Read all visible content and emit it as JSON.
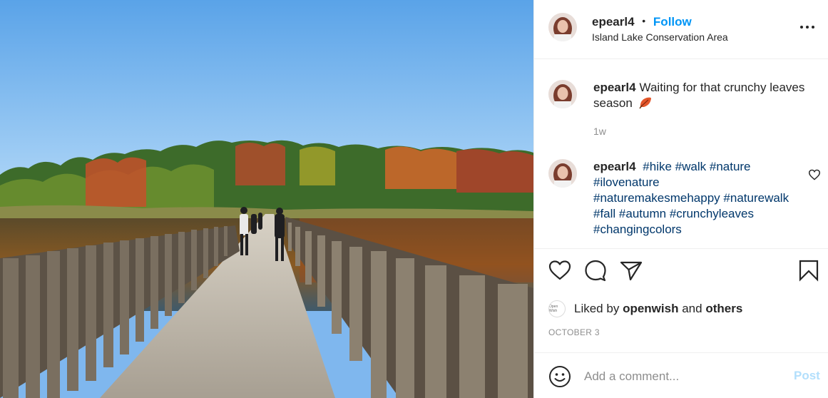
{
  "post": {
    "username": "epearl4",
    "follow_label": "Follow",
    "separator": "•",
    "location": "Island Lake Conservation Area",
    "more_icon": "more-horizontal-icon",
    "image_alt": "wooden-boardwalk-over-lake-with-autumn-trees"
  },
  "caption": {
    "username": "epearl4",
    "text": "Waiting for that crunchy leaves season",
    "emoji_icon": "fallen-leaf-icon",
    "time": "1w"
  },
  "comments": [
    {
      "username": "epearl4",
      "tags": [
        "#hike",
        "#walk",
        "#nature",
        "#ilovenature",
        "#naturemakesmehappy",
        "#naturewalk",
        "#fall",
        "#autumn",
        "#crunchyleaves",
        "#changingcolors"
      ]
    }
  ],
  "actions": {
    "like_icon": "heart-icon",
    "comment_icon": "comment-bubble-icon",
    "share_icon": "paper-plane-icon",
    "save_icon": "bookmark-icon"
  },
  "likes": {
    "prefix": "Liked by",
    "user": "openwish",
    "conjunction": "and",
    "others": "others",
    "avatar_text": "Open Wish"
  },
  "date": "OCTOBER 3",
  "add_comment": {
    "placeholder": "Add a comment...",
    "post_label": "Post",
    "emoji_icon": "smiley-icon"
  },
  "colors": {
    "link_blue": "#0095f6",
    "hashtag": "#00376b",
    "muted": "#8e8e8e",
    "post_disabled": "#b2dffc"
  }
}
